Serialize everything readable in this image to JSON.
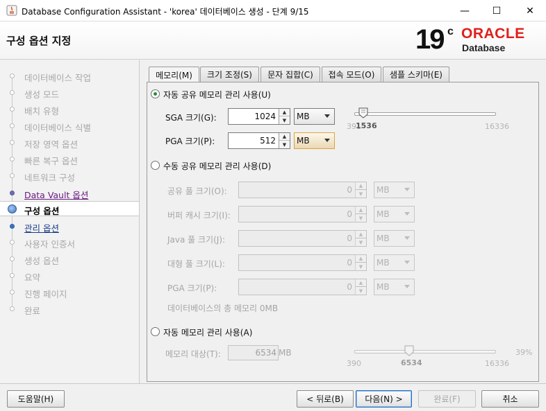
{
  "window": {
    "title": "Database Configuration Assistant - 'korea' 데이터베이스 생성 - 단계 9/15",
    "minimize": "—",
    "maximize": "☐",
    "close": "✕"
  },
  "header": {
    "page_title": "구성 옵션 지정",
    "brand_version": "19",
    "brand_c": "c",
    "brand_oracle": "ORACLE",
    "brand_database": "Database"
  },
  "steps": [
    {
      "label": "데이터베이스 작업",
      "state": "pending"
    },
    {
      "label": "생성 모드",
      "state": "pending"
    },
    {
      "label": "배치 유형",
      "state": "pending"
    },
    {
      "label": "데이터베이스 식별",
      "state": "pending"
    },
    {
      "label": "저장 영역 옵션",
      "state": "pending"
    },
    {
      "label": "빠른 복구 옵션",
      "state": "pending"
    },
    {
      "label": "네트워크 구성",
      "state": "pending"
    },
    {
      "label": "Data Vault 옵션",
      "state": "done"
    },
    {
      "label": "구성 옵션",
      "state": "active"
    },
    {
      "label": "관리 옵션",
      "state": "next"
    },
    {
      "label": "사용자 인증서",
      "state": "pending"
    },
    {
      "label": "생성 옵션",
      "state": "pending"
    },
    {
      "label": "요약",
      "state": "pending"
    },
    {
      "label": "진행 페이지",
      "state": "pending"
    },
    {
      "label": "완료",
      "state": "pending"
    }
  ],
  "tabs": [
    {
      "label": "메모리(M)"
    },
    {
      "label": "크기 조정(S)"
    },
    {
      "label": "문자 집합(C)"
    },
    {
      "label": "접속 모드(O)"
    },
    {
      "label": "샘플 스키마(E)"
    }
  ],
  "memory": {
    "asmm_label": "자동 공유 메모리 관리 사용(U)",
    "sga_label": "SGA 크기(G):",
    "sga_value": "1024",
    "sga_unit": "MB",
    "pga_label": "PGA 크기(P):",
    "pga_value": "512",
    "pga_unit": "MB",
    "slider1_min": "391",
    "slider1_current": "1536",
    "slider1_max": "16336",
    "manual_label": "수동 공유 메모리 관리 사용(D)",
    "shared_pool_label": "공유 풀 크기(O):",
    "buffer_cache_label": "버퍼 캐시 크기(I):",
    "java_pool_label": "Java 풀 크기(J):",
    "large_pool_label": "대형 풀 크기(L):",
    "pga2_label": "PGA 크기(P):",
    "zero": "0",
    "mb": "MB",
    "total_label": "데이터베이스의 총 메모리 0MB",
    "amm_label": "자동 메모리 관리 사용(A)",
    "target_label": "메모리 대상(T):",
    "target_value": "6534",
    "target_unit": "MB",
    "slider2_min": "390",
    "slider2_current": "6534",
    "slider2_max": "16336",
    "slider2_percent": "39%"
  },
  "footer": {
    "help": "도움말(H)",
    "back": "< 뒤로(B)",
    "next": "다음(N) >",
    "finish": "완료(F)",
    "cancel": "취소"
  }
}
